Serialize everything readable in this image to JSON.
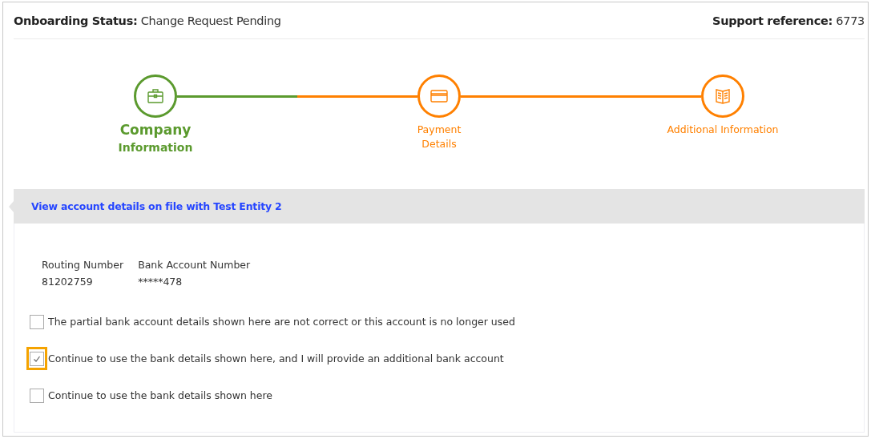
{
  "header": {
    "status_label": "Onboarding Status:",
    "status_value": "Change Request Pending",
    "reference_label": "Support reference:",
    "reference_value": "6773"
  },
  "steps": [
    {
      "lines": [
        "Company",
        "Information"
      ],
      "completed": true,
      "current": true
    },
    {
      "lines": [
        "Payment",
        "Details"
      ],
      "completed": false,
      "current": false
    },
    {
      "lines": [
        "Additional Information"
      ],
      "completed": false,
      "current": false
    }
  ],
  "banner": {
    "link": "View account details on file with Test Entity 2"
  },
  "account": [
    {
      "label": "Routing Number",
      "value": "81202759"
    },
    {
      "label": "Bank Account Number",
      "value": "*****478"
    }
  ],
  "options": [
    {
      "label": "The partial bank account details shown here are not correct or this account is no longer used",
      "checked": false,
      "focused": false
    },
    {
      "label": "Continue to use the bank details shown here, and I will provide an additional bank account",
      "checked": true,
      "focused": true
    },
    {
      "label": "Continue to use the bank details shown here",
      "checked": false,
      "focused": false
    }
  ]
}
